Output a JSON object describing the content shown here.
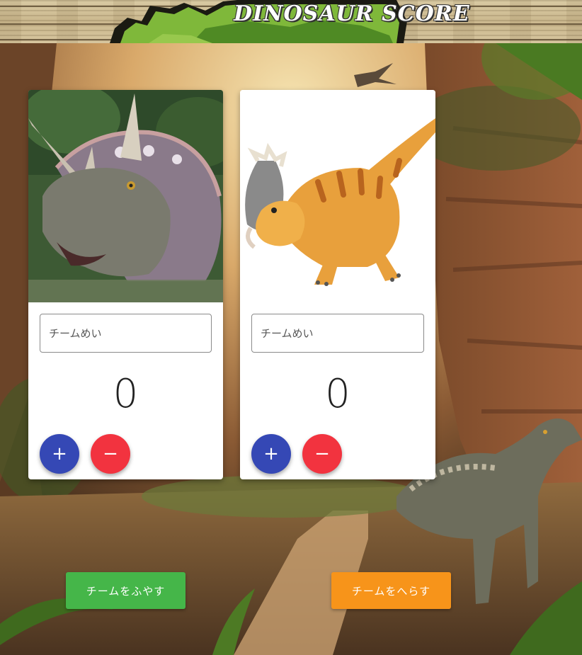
{
  "header": {
    "title": "DINOSAUR SCORE"
  },
  "teams": [
    {
      "photo": "triceratops-photo",
      "name_placeholder": "チームめい",
      "name_value": "",
      "score": "0",
      "plus_label": "+",
      "minus_label": "−"
    },
    {
      "photo": "pachyrhinosaurus-illustration",
      "name_placeholder": "チームめい",
      "name_value": "",
      "score": "0",
      "plus_label": "+",
      "minus_label": "−"
    }
  ],
  "actions": {
    "add_team_label": "チームをふやす",
    "remove_team_label": "チームをへらす"
  },
  "colors": {
    "plus_button": "#3548b5",
    "minus_button": "#f2333f",
    "add_team_button": "#45b649",
    "remove_team_button": "#f7941a"
  }
}
